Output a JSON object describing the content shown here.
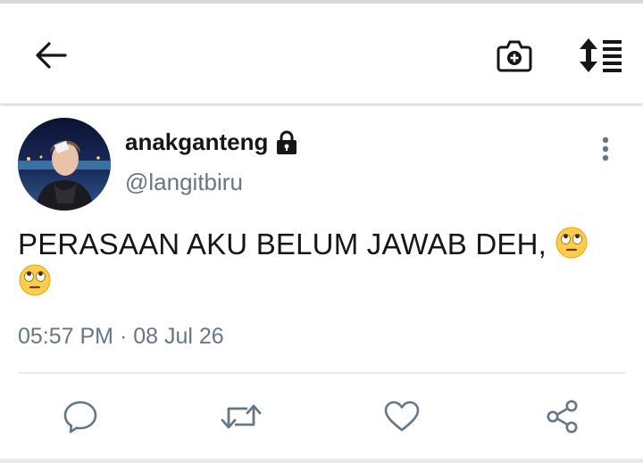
{
  "header": {
    "back_icon": "arrow-left-icon",
    "camera_icon": "camera-add-icon",
    "sort_icon": "sort-list-icon"
  },
  "tweet": {
    "display_name": "anakganteng",
    "handle": "@langitbiru",
    "text": "PERASAAN AKU BELUM JAWAB DEH,",
    "time": "05:57 PM",
    "separator": "·",
    "date": "08 Jul 26",
    "protected_icon": "lock-icon",
    "emoji": "face-with-rolling-eyes"
  },
  "actions": [
    "reply-icon",
    "retweet-icon",
    "like-icon",
    "share-icon"
  ],
  "colors": {
    "text": "#14171a",
    "muted": "#657786",
    "icon": "#657786"
  }
}
